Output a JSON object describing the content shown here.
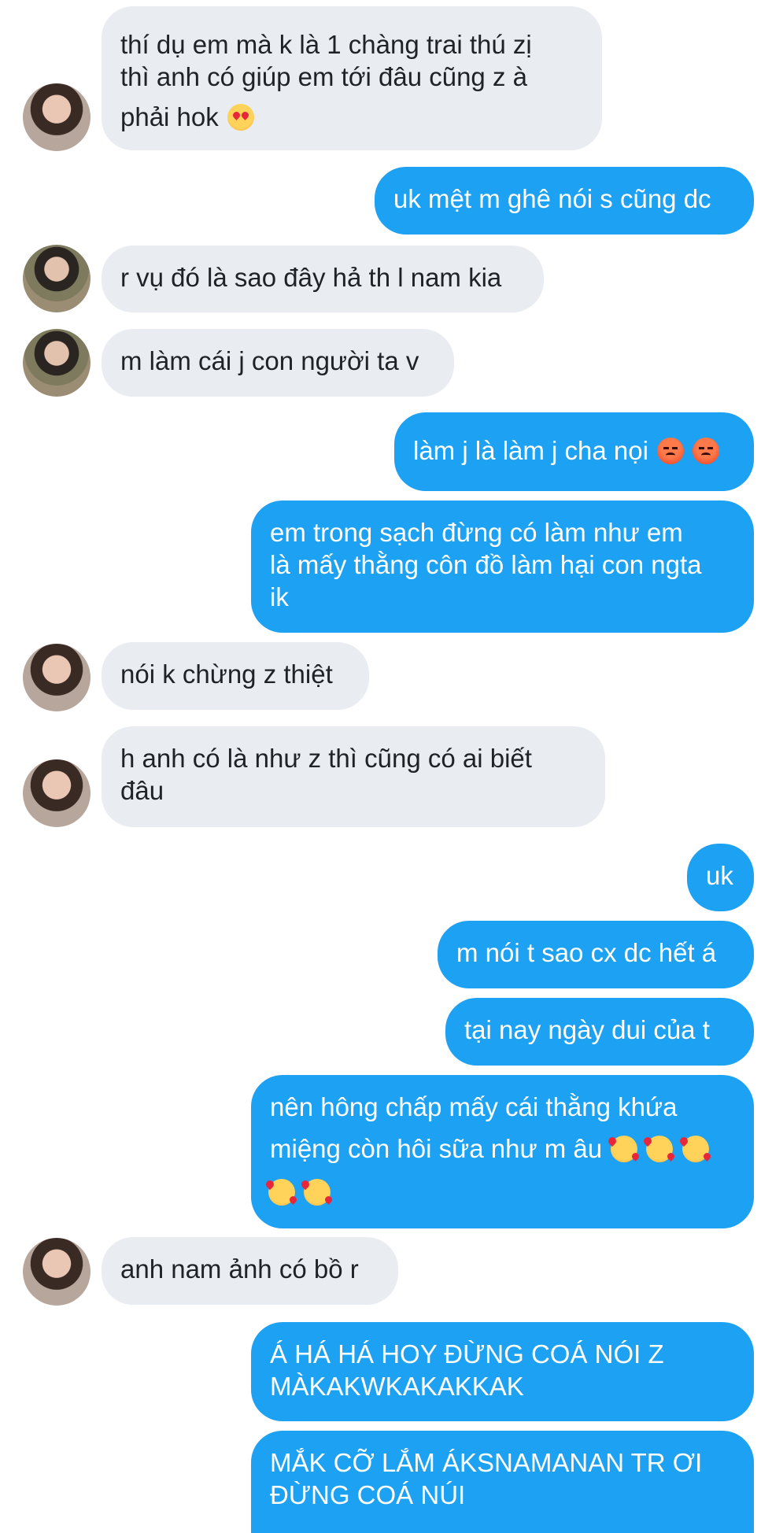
{
  "colors": {
    "sent_bubble": "#1da1f2",
    "received_bubble": "#e9ecf1",
    "background": "#ffffff"
  },
  "icons": {
    "heart_eyes": "smiling-face-with-heart-eyes-icon",
    "angry": "angry-face-icon",
    "hearts": "smiling-face-with-hearts-icon"
  },
  "messages": [
    {
      "from": "other",
      "lines": [
        "thí dụ em mà k là 1 chàng trai thú zị",
        "thì anh có giúp em tới đâu cũng z à",
        "phải hok"
      ]
    },
    {
      "from": "me",
      "lines": [
        "uk mệt m ghê nói s cũng dc"
      ]
    },
    {
      "from": "other",
      "lines": [
        "r vụ đó là sao đây hả th l nam kia"
      ]
    },
    {
      "from": "other",
      "lines": [
        "m làm cái j con người ta v"
      ]
    },
    {
      "from": "me",
      "lines": [
        "làm j là làm j cha nọi"
      ]
    },
    {
      "from": "me",
      "lines": [
        "em trong sạch đừng có làm như em",
        "là mấy thằng côn đồ làm hại con ngta",
        "ik"
      ]
    },
    {
      "from": "other",
      "lines": [
        "nói k chừng z thiệt"
      ]
    },
    {
      "from": "other",
      "lines": [
        "h anh có là như z thì cũng có ai biết",
        "đâu"
      ]
    },
    {
      "from": "me",
      "lines": [
        "uk"
      ]
    },
    {
      "from": "me",
      "lines": [
        "m nói t sao cx dc hết á"
      ]
    },
    {
      "from": "me",
      "lines": [
        "tại nay ngày dui của t"
      ]
    },
    {
      "from": "me",
      "lines": [
        "nên hông chấp mấy cái thằng khứa",
        "miệng còn hôi sữa như m âu"
      ]
    },
    {
      "from": "other",
      "lines": [
        "anh nam ảnh có bồ r"
      ]
    },
    {
      "from": "me",
      "lines": [
        "Á HÁ HÁ HOY ĐỪNG COÁ NÓI Z",
        "MÀKAKWKAKAKKAK"
      ]
    },
    {
      "from": "me",
      "lines": [
        "MẮK CỠ LẮM ÁKSNAMANAN TR ƠI",
        "ĐỪNG COÁ NÚI"
      ]
    }
  ]
}
